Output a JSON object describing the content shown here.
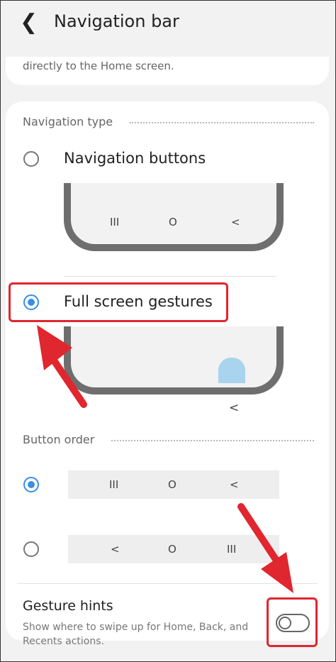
{
  "header": {
    "title": "Navigation bar",
    "back_icon": "chevron-left-icon"
  },
  "intro": {
    "text": "directly to the Home screen."
  },
  "navigation_type": {
    "heading": "Navigation type",
    "options": [
      {
        "label": "Navigation buttons",
        "selected": false
      },
      {
        "label": "Full screen gestures",
        "selected": true
      }
    ],
    "preview_keys": {
      "recents": "III",
      "home": "O",
      "back": "<"
    },
    "gesture_back": "<"
  },
  "button_order": {
    "heading": "Button order",
    "options": [
      {
        "keys": [
          "III",
          "O",
          "<"
        ],
        "selected": true
      },
      {
        "keys": [
          "<",
          "O",
          "III"
        ],
        "selected": false
      }
    ]
  },
  "gesture_hints": {
    "title": "Gesture hints",
    "description": "Show where to swipe up for Home, Back, and Recents actions.",
    "enabled": false
  },
  "colors": {
    "accent": "#3a8ee6",
    "highlight": "#e0262e",
    "gesture_handle": "#a8d4ee"
  }
}
